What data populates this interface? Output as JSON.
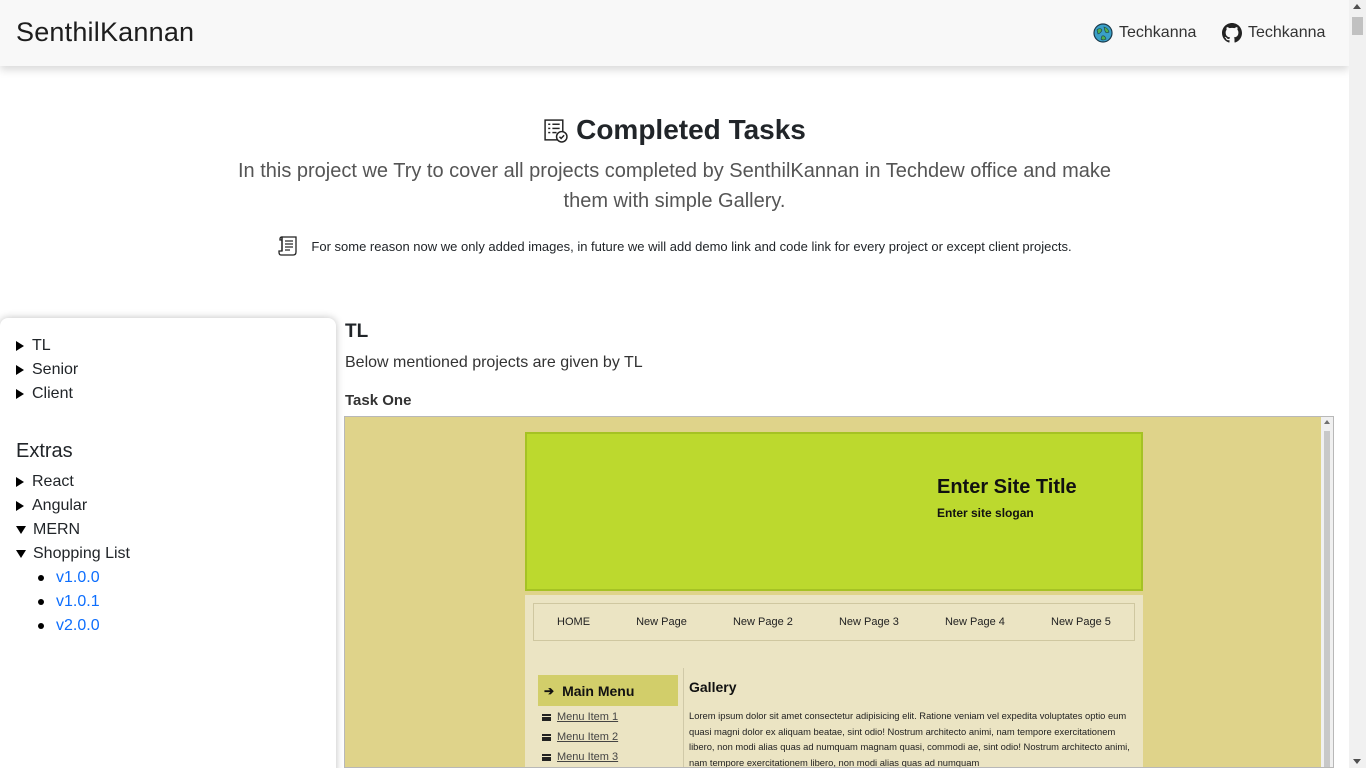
{
  "navbar": {
    "brand": "SenthilKannan",
    "links": [
      {
        "label": "Techkanna",
        "icon": "globe-icon"
      },
      {
        "label": "Techkanna",
        "icon": "github-icon"
      }
    ]
  },
  "hero": {
    "title": "Completed Tasks",
    "title_icon": "checklist-icon",
    "lead": "In this project we Try to cover all projects completed by SenthilKannan in Techdew office and make them with simple Gallery.",
    "note": "For some reason now we only added images, in future we will add demo link and code link for every project or except client projects.",
    "note_icon": "scroll-document-icon"
  },
  "sidebar": {
    "groups": [
      {
        "label": "TL",
        "expanded": false
      },
      {
        "label": "Senior",
        "expanded": false
      },
      {
        "label": "Client",
        "expanded": false
      }
    ],
    "extras_title": "Extras",
    "extras": [
      {
        "label": "React",
        "expanded": false
      },
      {
        "label": "Angular",
        "expanded": false
      },
      {
        "label": "MERN",
        "expanded": true
      },
      {
        "label": "Shopping List",
        "expanded": true
      }
    ],
    "versions": [
      "v1.0.0",
      "v1.0.1",
      "v2.0.0"
    ]
  },
  "content": {
    "heading": "TL",
    "description": "Below mentioned projects are given by TL",
    "task_title": "Task One"
  },
  "preview": {
    "site_title": "Enter Site Title",
    "site_slogan": "Enter site slogan",
    "nav": [
      "HOME",
      "New Page",
      "New Page 2",
      "New Page 3",
      "New Page 4",
      "New Page 5"
    ],
    "main_menu": "Main Menu",
    "menu_items": [
      "Menu Item 1",
      "Menu Item 2",
      "Menu Item 3"
    ],
    "gallery_title": "Gallery",
    "gallery_text": "Lorem ipsum dolor sit amet consectetur adipisicing elit. Ratione veniam vel expedita voluptates optio eum quasi magni dolor ex aliquam beatae, sint odio! Nostrum architecto animi, nam tempore exercitationem libero, non modi alias quas ad numquam magnam quasi, commodi ae, sint odio! Nostrum architecto animi, nam tempore exercitationem libero, non modi alias quas ad numquam",
    "colors": {
      "background": "#dfd38a",
      "header": "#bcd92e",
      "body": "#ebe4c3",
      "menu": "#d2ce6a"
    }
  },
  "colors": {
    "link": "#0d6efd",
    "navbar_bg": "#f8f8f8"
  }
}
